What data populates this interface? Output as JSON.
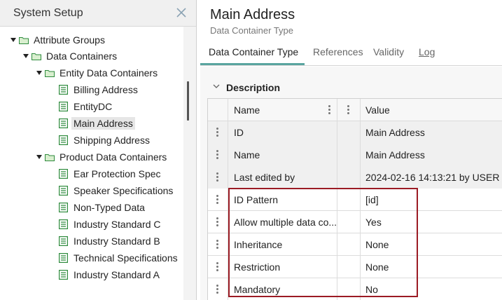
{
  "left_panel": {
    "title": "System Setup",
    "tree": [
      {
        "label": "Attribute Groups",
        "kind": "folder"
      },
      {
        "label": "Data Containers",
        "kind": "folder"
      },
      {
        "label": "Entity Data Containers",
        "kind": "folder"
      },
      {
        "label": "Billing Address",
        "kind": "item"
      },
      {
        "label": "EntityDC",
        "kind": "item"
      },
      {
        "label": "Main Address",
        "kind": "item",
        "selected": true
      },
      {
        "label": "Shipping Address",
        "kind": "item"
      },
      {
        "label": "Product Data Containers",
        "kind": "folder"
      },
      {
        "label": "Ear Protection Spec",
        "kind": "item"
      },
      {
        "label": "Speaker Specifications",
        "kind": "item"
      },
      {
        "label": "Non-Typed Data",
        "kind": "item"
      },
      {
        "label": "Industry Standard C",
        "kind": "item"
      },
      {
        "label": "Industry Standard B",
        "kind": "item"
      },
      {
        "label": "Technical Specifications",
        "kind": "item"
      },
      {
        "label": "Industry Standard A",
        "kind": "item"
      }
    ]
  },
  "main": {
    "title": "Main Address",
    "subtitle": "Data Container Type",
    "tabs": [
      {
        "label": "Data Container Type",
        "active": true
      },
      {
        "label": "References"
      },
      {
        "label": "Validity"
      },
      {
        "label": "Log"
      }
    ],
    "section_title": "Description",
    "grid": {
      "columns": [
        "Name",
        "Value"
      ],
      "rows": [
        {
          "name": "ID",
          "value": "Main Address"
        },
        {
          "name": "Name",
          "value": "Main Address"
        },
        {
          "name": "Last edited by",
          "value": "2024-02-16 14:13:21 by USER"
        },
        {
          "name": "ID Pattern",
          "value": "[id]"
        },
        {
          "name": "Allow multiple data co...",
          "value": "Yes"
        },
        {
          "name": "Inheritance",
          "value": "None"
        },
        {
          "name": "Restriction",
          "value": "None"
        },
        {
          "name": "Mandatory",
          "value": "No"
        }
      ]
    }
  },
  "colors": {
    "accent_tab": "#5aa5a0",
    "highlight_border": "#9b1b24",
    "tree_icon_green": "#2e8b3d"
  },
  "icons": {
    "close": "close-icon",
    "expand": "caret-down-icon",
    "folder": "folder-icon",
    "item": "document-icon",
    "handle": "kebab-icon"
  }
}
